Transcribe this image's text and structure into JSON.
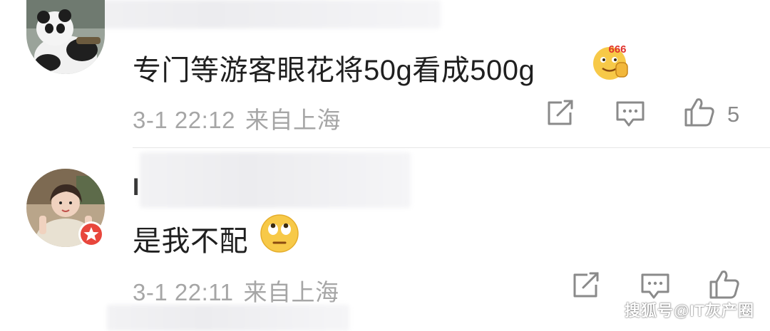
{
  "comments": [
    {
      "text": "专门等游客眼花将50g看成500g",
      "emoji": "666-thumbs-emoji",
      "emoji_label": "666",
      "time": "3-1 22:12",
      "location": "来自上海",
      "like_count": "5"
    },
    {
      "name_stub": "I",
      "text": "是我不配",
      "emoji": "rolling-eyes-emoji",
      "time": "3-1 22:11",
      "location": "来自上海",
      "like_count": ""
    }
  ],
  "watermark": "搜狐号@IT灰产圈",
  "colors": {
    "text": "#1f1f1f",
    "meta": "#a6a6a6",
    "icon": "#8a8a8a",
    "badge": "#e8463c",
    "emoji": "#f7c948"
  }
}
